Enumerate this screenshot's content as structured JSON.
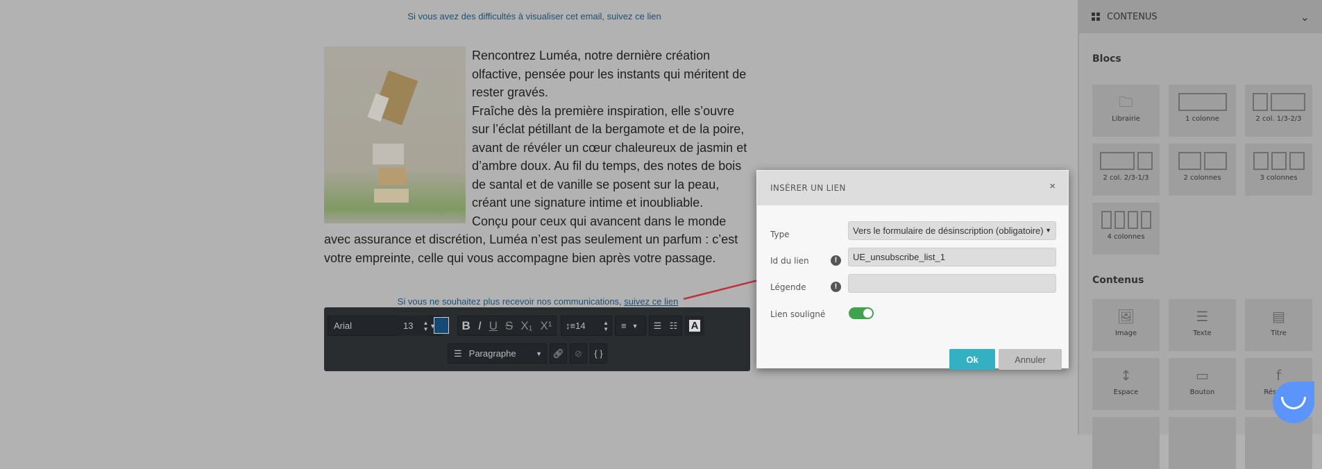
{
  "email": {
    "view_link": "Si vous avez des difficultés à visualiser cet email, suivez ce lien",
    "paragraphs": [
      "Rencontrez Luméa, notre dernière création olfactive, pensée pour les instants qui méritent de rester gravés.",
      "Fraîche dès la première inspiration, elle s’ouvre sur l’éclat pétillant de la bergamote et de la poire, avant de révéler un cœur chaleureux de jasmin et d’ambre doux. Au fil du temps, des notes de bois de santal et de vanille se posent sur la peau, créant une signature intime et inoubliable.",
      "Conçu pour ceux qui avancent dans le monde avec assurance et discrétion, Luméa n’est pas seulement un parfum : c’est votre empreinte, celle qui vous accompagne bien après votre passage."
    ],
    "unsub_text": "Si vous ne souhaitez plus recevoir nos communications, ",
    "unsub_link": "suivez ce lien"
  },
  "toolbar": {
    "font": "Arial",
    "size": "13",
    "text_color": "#154a75",
    "line_height": "14",
    "format": "Paragraphe"
  },
  "dialog": {
    "title": "INSÉRER UN LIEN",
    "close": "×",
    "type_label": "Type",
    "type_value": "Vers le formulaire de désinscription (obligatoire)",
    "id_label": "Id du lien",
    "id_value": "UE_unsubscribe_list_1",
    "caption_label": "Légende",
    "caption_value": "",
    "underline_label": "Lien souligné",
    "underline_on": true,
    "ok": "Ok",
    "cancel": "Annuler"
  },
  "sidebar": {
    "title": "CONTENUS",
    "blocks_heading": "Blocs",
    "blocks": [
      "Librairie",
      "1 colonne",
      "2 col. 1/3-2/3",
      "2 col. 2/3-1/3",
      "2 colonnes",
      "3 colonnes",
      "4 colonnes"
    ],
    "contents_heading": "Contenus",
    "contents": [
      "Image",
      "Texte",
      "Titre",
      "Espace",
      "Bouton",
      "Réseaux"
    ]
  },
  "colors": {
    "accent": "#33b0c1",
    "toggle": "#3fa34d",
    "link": "#1e4f72",
    "chat": "#5b95fb"
  }
}
